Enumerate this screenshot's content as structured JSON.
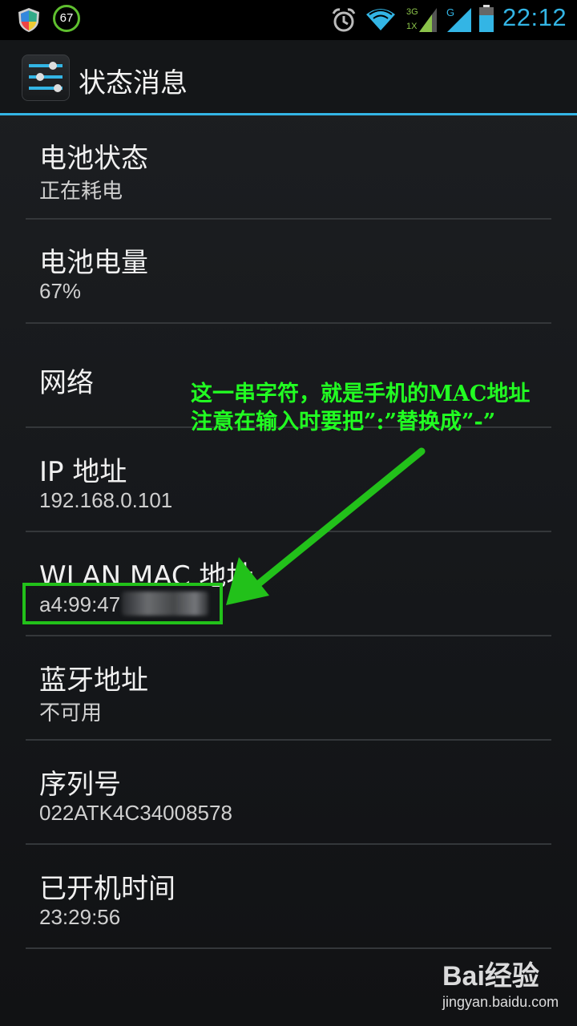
{
  "status_bar": {
    "battery_badge": "67",
    "time": "22:12",
    "network_labels": [
      "3G",
      "1X",
      "G"
    ],
    "icons": [
      "shield-icon",
      "battery-circle-icon",
      "alarm-icon",
      "wifi-icon",
      "signal-icon",
      "battery-icon"
    ]
  },
  "header": {
    "title": "状态消息",
    "icon": "settings-sliders-icon"
  },
  "items": [
    {
      "title": "电池状态",
      "value": "正在耗电"
    },
    {
      "title": "电池电量",
      "value": "67%"
    },
    {
      "title": "网络",
      "value": ""
    },
    {
      "title": "IP 地址",
      "value": "192.168.0.101"
    },
    {
      "title": "WLAN MAC 地址",
      "value": "a4:99:47"
    },
    {
      "title": "蓝牙地址",
      "value": "不可用"
    },
    {
      "title": "序列号",
      "value": "022ATK4C34008578"
    },
    {
      "title": "已开机时间",
      "value": "23:29:56"
    }
  ],
  "annotation": {
    "line1": "这一串字符，就是手机的MAC地址",
    "line2": "注意在输入时要把”:”替换成”-”",
    "color": "#22ff22"
  },
  "watermark": {
    "logo": "Bai经验",
    "url": "jingyan.baidu.com"
  },
  "colors": {
    "accent": "#33b5e5",
    "annotation": "#22c11a"
  }
}
